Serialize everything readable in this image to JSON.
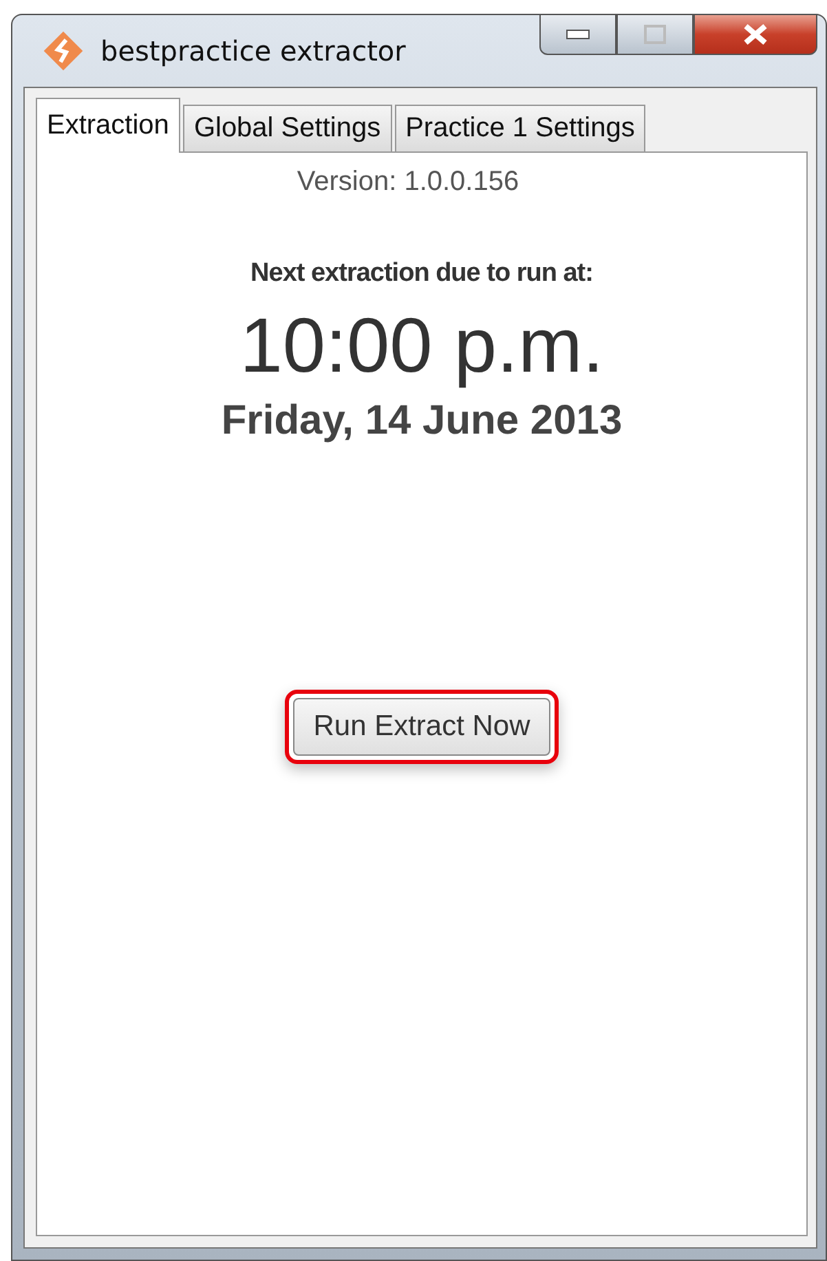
{
  "window": {
    "title": "bestpractice extractor"
  },
  "tabs": [
    {
      "label": "Extraction",
      "selected": true
    },
    {
      "label": "Global Settings",
      "selected": false
    },
    {
      "label": "Practice 1 Settings",
      "selected": false
    }
  ],
  "version": "Version: 1.0.0.156",
  "next_label": "Next extraction due to run at:",
  "time": "10:00 p.m.",
  "date": "Friday, 14 June 2013",
  "button": {
    "label": "Run Extract Now",
    "highlighted": true
  }
}
